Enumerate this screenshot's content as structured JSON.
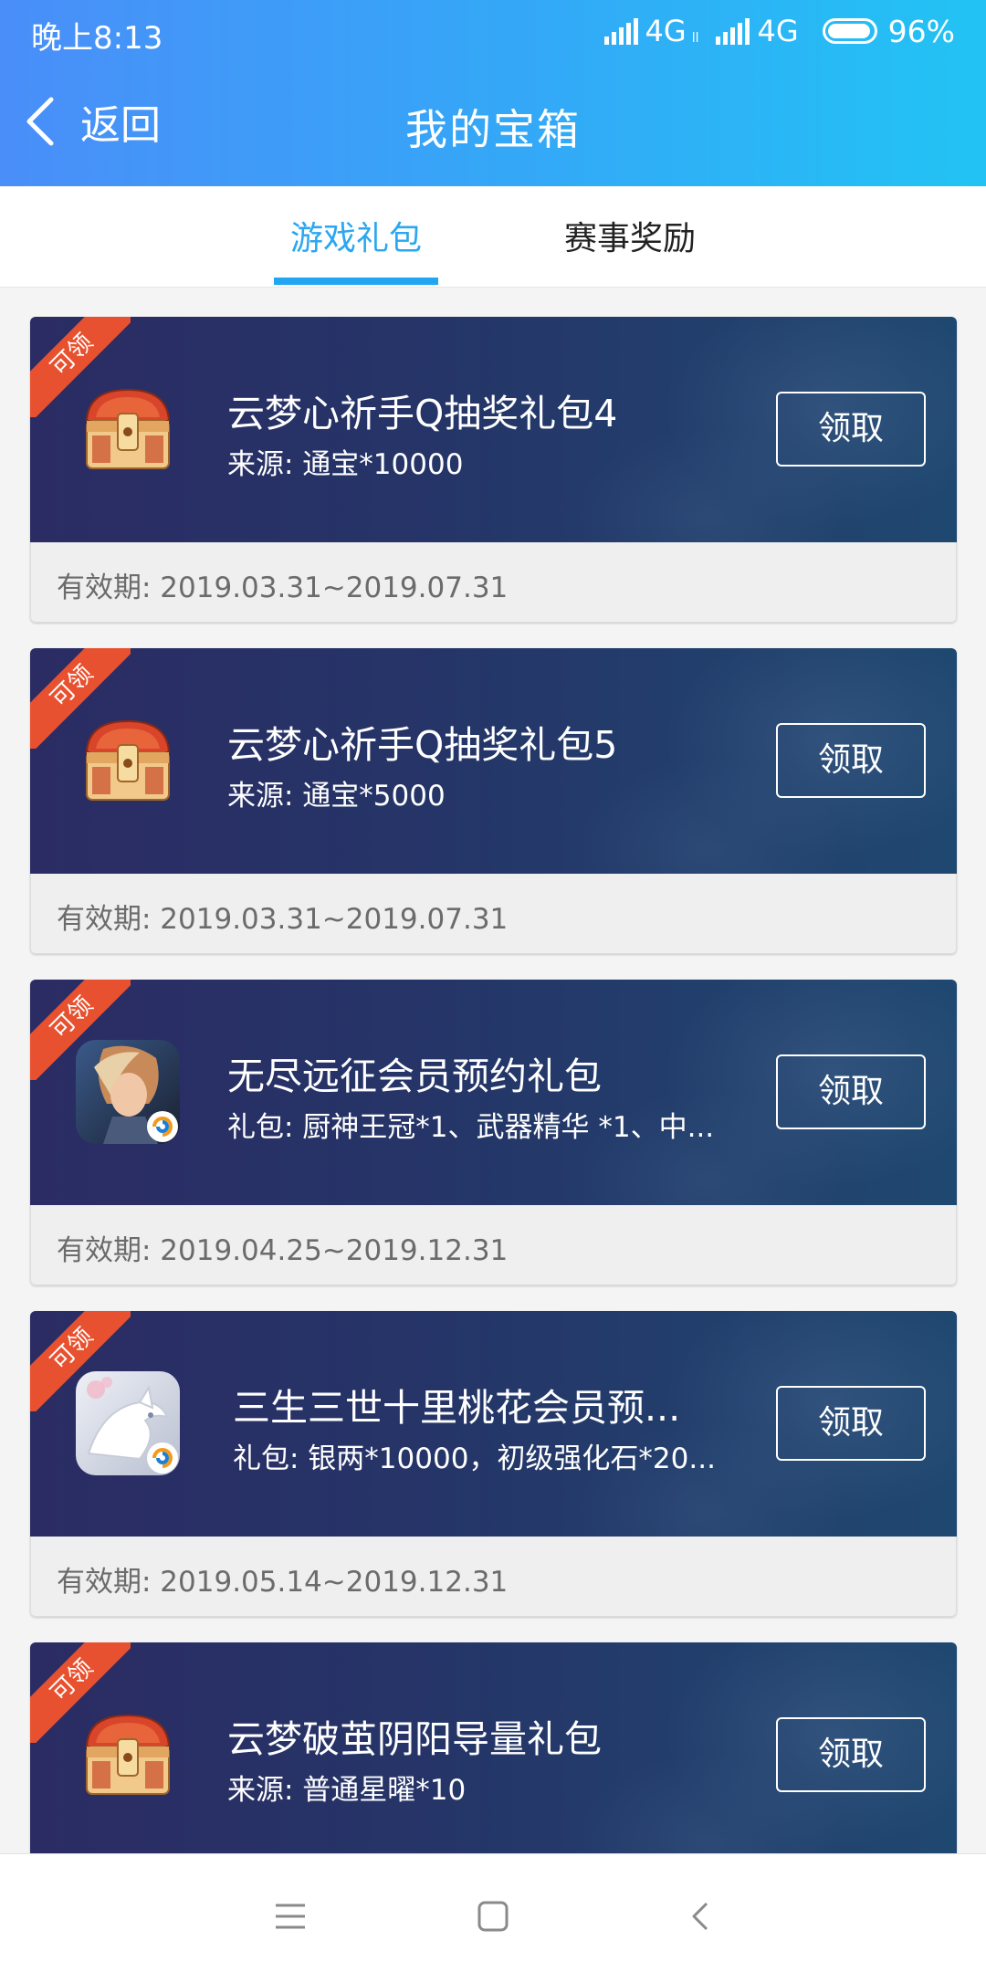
{
  "status_bar": {
    "time": "晚上8:13",
    "network1": "4G",
    "network1_sub": "ll",
    "network2": "4G",
    "battery_percent": "96%",
    "battery_level": 0.96
  },
  "header": {
    "back_label": "返回",
    "title": "我的宝箱"
  },
  "tabs": [
    {
      "label": "游戏礼包",
      "active": true
    },
    {
      "label": "赛事奖励",
      "active": false
    }
  ],
  "cards": [
    {
      "badge": "可领",
      "icon": "treasure-chest-icon",
      "title": "云梦心祈手Q抽奖礼包4",
      "subtitle": "来源: 通宝*10000",
      "button": "领取",
      "validity": "有效期: 2019.03.31~2019.07.31"
    },
    {
      "badge": "可领",
      "icon": "treasure-chest-icon",
      "title": "云梦心祈手Q抽奖礼包5",
      "subtitle": "来源: 通宝*5000",
      "button": "领取",
      "validity": "有效期: 2019.03.31~2019.07.31"
    },
    {
      "badge": "可领",
      "icon": "game-app-icon",
      "title": "无尽远征会员预约礼包",
      "subtitle": "礼包: 厨神王冠*1、武器精华 *1、中...",
      "button": "领取",
      "validity": "有效期: 2019.04.25~2019.12.31"
    },
    {
      "badge": "可领",
      "icon": "game-app-icon",
      "title": "三生三世十里桃花会员预...",
      "subtitle": "礼包: 银两*10000，初级强化石*20...",
      "button": "领取",
      "validity": "有效期: 2019.05.14~2019.12.31"
    },
    {
      "badge": "可领",
      "icon": "treasure-chest-icon",
      "title": "云梦破茧阴阳导量礼包",
      "subtitle": "来源: 普通星曜*10",
      "button": "领取",
      "validity": ""
    }
  ],
  "bottom_nav": {
    "menu_icon": "menu-icon",
    "home_icon": "home-square-icon",
    "back_icon": "back-chevron-icon"
  },
  "colors": {
    "header_start": "#4a8ef9",
    "header_end": "#22c3f4",
    "tab_active": "#22a6f2",
    "ribbon": "#e8512f",
    "card_dark": "#2b2c64"
  }
}
